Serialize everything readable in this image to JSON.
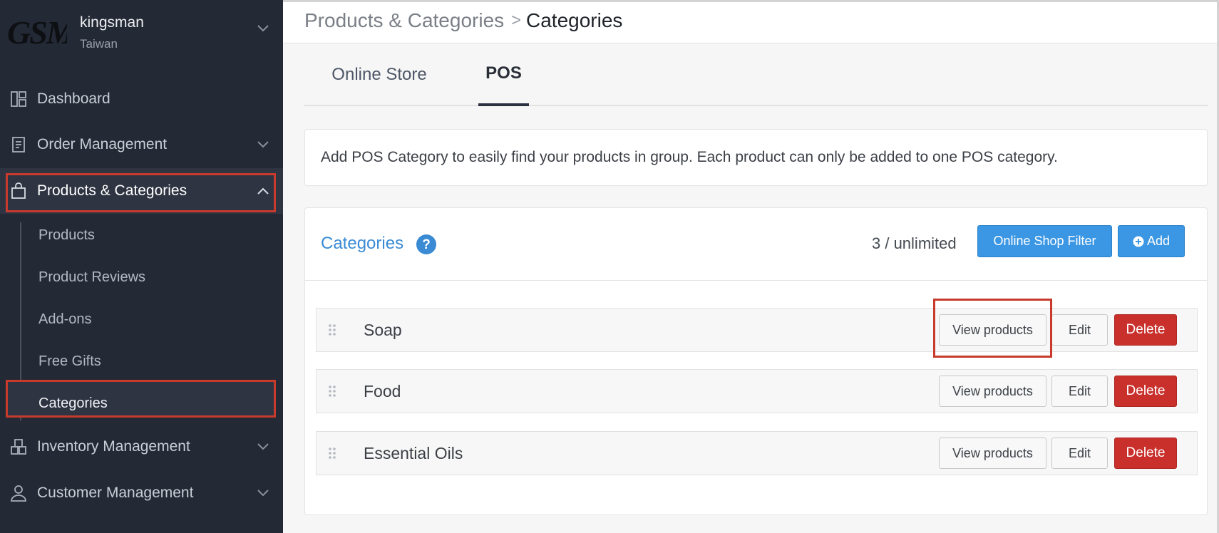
{
  "shop": {
    "logo_text": "GSM",
    "name": "kingsman",
    "region": "Taiwan"
  },
  "sidebar": {
    "items": [
      {
        "label": "Dashboard",
        "icon": "dashboard-icon",
        "has_chevron": false
      },
      {
        "label": "Order Management",
        "icon": "clipboard-icon",
        "has_chevron": true
      },
      {
        "label": "Products & Categories",
        "icon": "shopping-bag-icon",
        "has_chevron": true,
        "expanded": true
      },
      {
        "label": "Inventory Management",
        "icon": "boxes-icon",
        "has_chevron": true
      },
      {
        "label": "Customer Management",
        "icon": "user-icon",
        "has_chevron": true
      }
    ],
    "subitems": [
      "Products",
      "Product Reviews",
      "Add-ons",
      "Free Gifts",
      "Categories"
    ],
    "active_subitem": "Categories"
  },
  "breadcrumb": {
    "parent": "Products & Categories",
    "separator": ">",
    "current": "Categories"
  },
  "tabs": [
    {
      "label": "Online Store",
      "active": false
    },
    {
      "label": "POS",
      "active": true
    }
  ],
  "info": {
    "text": "Add POS Category to easily find your products in group. Each product can only be added to one POS category."
  },
  "categories_panel": {
    "title": "Categories",
    "count": "3 / unlimited",
    "filter_button": "Online Shop Filter",
    "add_button": "Add",
    "rows": [
      {
        "name": "Soap"
      },
      {
        "name": "Food"
      },
      {
        "name": "Essential Oils"
      }
    ],
    "row_buttons": {
      "view": "View products",
      "edit": "Edit",
      "delete": "Delete"
    }
  },
  "colors": {
    "sidebar_bg": "#232935",
    "highlight_border": "#c73a2c",
    "primary_blue": "#3b97e4",
    "danger_red": "#c9302c",
    "link_blue": "#3a8bd4"
  }
}
